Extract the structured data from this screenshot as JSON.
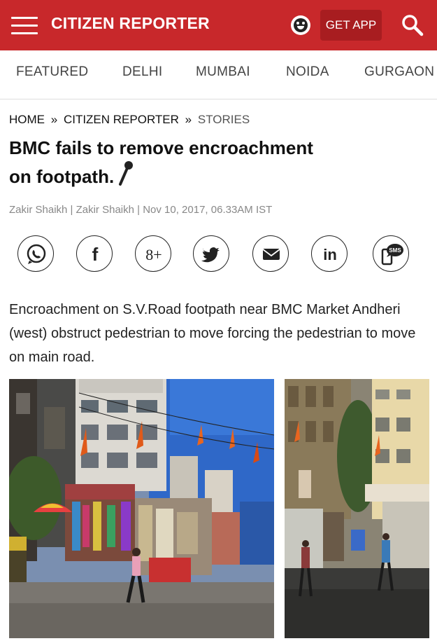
{
  "header": {
    "brand": "CITIZEN REPORTER",
    "get_app_label": "GET APP",
    "bg_color": "#c8282b"
  },
  "nav": {
    "items": [
      "FEATURED",
      "DELHI",
      "MUMBAI",
      "NOIDA",
      "GURGAON"
    ]
  },
  "breadcrumb": {
    "home": "HOME",
    "section": "CITIZEN REPORTER",
    "current": "STORIES",
    "separator": "»"
  },
  "article": {
    "title": "BMC fails to remove encroachment on footpath.",
    "byline": "Zakir Shaikh | Zakir Shaikh | Nov 10, 2017, 06.33AM IST",
    "summary": "Encroachment on S.V.Road footpath near BMC Market Andheri (west) obstruct pedestrian to move forcing the pedestrian to move on main road."
  },
  "share": {
    "icons": [
      "whatsapp-icon",
      "facebook-icon",
      "google-plus-icon",
      "twitter-icon",
      "email-icon",
      "linkedin-icon",
      "sms-icon"
    ],
    "sms_label": "SMS",
    "gplus_label": "8+",
    "fb_label": "f",
    "in_label": "in"
  },
  "icons": {
    "menu": "hamburger-icon",
    "emoji": "emoji-icon",
    "search": "search-icon",
    "mic": "microphone-icon"
  }
}
